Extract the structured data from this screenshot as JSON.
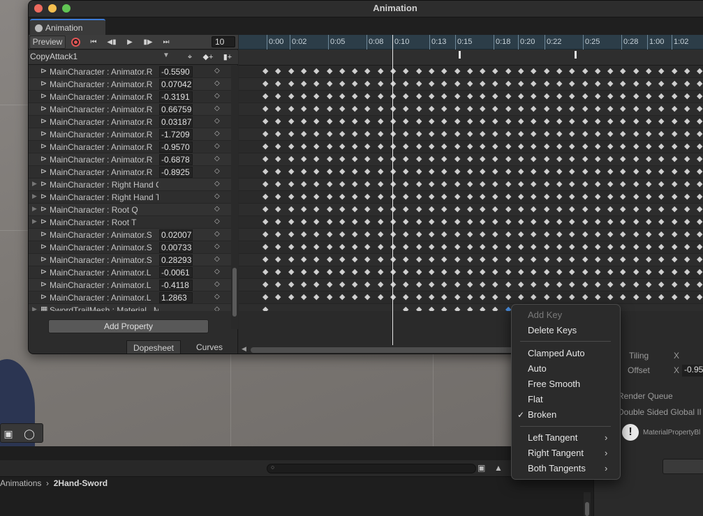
{
  "window": {
    "title": "Animation",
    "tab_label": "Animation"
  },
  "toolbar": {
    "preview_label": "Preview",
    "frame": "10"
  },
  "clip": {
    "name": "CopyAttack1"
  },
  "properties": [
    {
      "name": "MainCharacter : Animator.R",
      "value": "-0.5590",
      "expandable": false
    },
    {
      "name": "MainCharacter : Animator.R",
      "value": "0.07042",
      "expandable": false
    },
    {
      "name": "MainCharacter : Animator.R",
      "value": "-0.3191",
      "expandable": false
    },
    {
      "name": "MainCharacter : Animator.R",
      "value": "0.66759",
      "expandable": false
    },
    {
      "name": "MainCharacter : Animator.R",
      "value": "0.03187",
      "expandable": false
    },
    {
      "name": "MainCharacter : Animator.R",
      "value": "-1.7209",
      "expandable": false
    },
    {
      "name": "MainCharacter : Animator.R",
      "value": "-0.9570",
      "expandable": false
    },
    {
      "name": "MainCharacter : Animator.R",
      "value": "-0.6878",
      "expandable": false
    },
    {
      "name": "MainCharacter : Animator.R",
      "value": "-0.8925",
      "expandable": false
    },
    {
      "name": "MainCharacter : Right Hand Q",
      "value": "",
      "expandable": true
    },
    {
      "name": "MainCharacter : Right Hand T",
      "value": "",
      "expandable": true
    },
    {
      "name": "MainCharacter : Root Q",
      "value": "",
      "expandable": true
    },
    {
      "name": "MainCharacter : Root T",
      "value": "",
      "expandable": true
    },
    {
      "name": "MainCharacter : Animator.S",
      "value": "0.02007",
      "expandable": false
    },
    {
      "name": "MainCharacter : Animator.S",
      "value": "0.00733",
      "expandable": false
    },
    {
      "name": "MainCharacter : Animator.S",
      "value": "0.28293",
      "expandable": false
    },
    {
      "name": "MainCharacter : Animator.L",
      "value": "-0.0061",
      "expandable": false
    },
    {
      "name": "MainCharacter : Animator.L",
      "value": "-0.4118",
      "expandable": false
    },
    {
      "name": "MainCharacter : Animator.L",
      "value": "1.2863",
      "expandable": false
    },
    {
      "name": "SwordTrailMesh : Material._Main Tex_ST",
      "value": "",
      "expandable": true
    }
  ],
  "add_property_label": "Add Property",
  "view_tabs": [
    "Dopesheet",
    "Curves"
  ],
  "timeline": {
    "ticks": [
      "0:00",
      "0:02",
      "0:05",
      "0:08",
      "0:10",
      "0:13",
      "0:15",
      "0:18",
      "0:20",
      "0:22",
      "0:25",
      "0:28",
      "1:00",
      "1:02"
    ]
  },
  "context_menu": {
    "items": [
      {
        "label": "Add Key",
        "disabled": true,
        "checked": false,
        "submenu": false
      },
      {
        "label": "Delete Keys",
        "disabled": false,
        "checked": false,
        "submenu": false
      },
      {
        "label": "Clamped Auto",
        "disabled": false,
        "checked": false,
        "submenu": false
      },
      {
        "label": "Auto",
        "disabled": false,
        "checked": false,
        "submenu": false
      },
      {
        "label": "Free Smooth",
        "disabled": false,
        "checked": false,
        "submenu": false
      },
      {
        "label": "Flat",
        "disabled": false,
        "checked": false,
        "submenu": false
      },
      {
        "label": "Broken",
        "disabled": false,
        "checked": true,
        "submenu": false
      },
      {
        "label": "Left Tangent",
        "disabled": false,
        "checked": false,
        "submenu": true
      },
      {
        "label": "Right Tangent",
        "disabled": false,
        "checked": false,
        "submenu": true
      },
      {
        "label": "Both Tangents",
        "disabled": false,
        "checked": false,
        "submenu": true
      }
    ]
  },
  "inspector": {
    "tiling": "Tiling",
    "x_label": "X",
    "offset": "Offset",
    "offset_value": "-0.95",
    "render_queue": "Render Queue",
    "double_sided": "Double Sided Global Il",
    "material_block": "MaterialPropertyBl"
  },
  "breadcrumb": {
    "parent": "Animations",
    "current": "2Hand-Sword"
  },
  "colors": {
    "accent": "#3d7bd6",
    "record": "#e05555",
    "ruler": "#2c3d48"
  }
}
